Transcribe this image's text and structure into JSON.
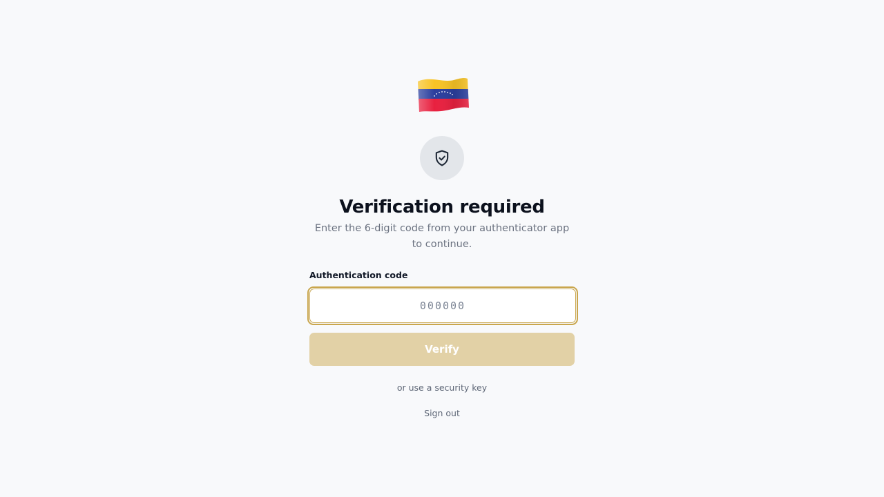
{
  "header": {
    "logo_icon": "venezuela-flag-icon",
    "badge_icon": "shield-check-icon"
  },
  "main": {
    "title": "Verification required",
    "subtitle": "Enter the 6-digit code from your authenticator app to continue.",
    "code_label": "Authentication code",
    "code_placeholder": "000000",
    "code_value": "",
    "verify_label": "Verify",
    "security_key_link": "or use a security key",
    "sign_out_link": "Sign out"
  },
  "colors": {
    "background": "#f8f9fb",
    "accent": "#c9a64d",
    "button_disabled": "#e2d1a6",
    "title": "#0c111d",
    "muted_text": "#6b7280"
  }
}
